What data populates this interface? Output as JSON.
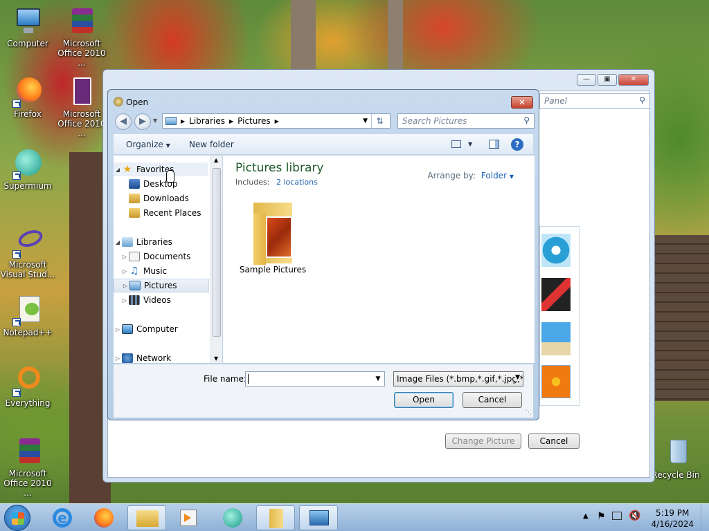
{
  "desktop": {
    "icons": [
      {
        "label": "Computer"
      },
      {
        "label": "Microsoft Office 2010 ..."
      },
      {
        "label": "Firefox"
      },
      {
        "label": "Microsoft Office 2010 ..."
      },
      {
        "label": "Supermium"
      },
      {
        "label": "Microsoft Visual Stud..."
      },
      {
        "label": "Notepad++"
      },
      {
        "label": "Everything"
      },
      {
        "label": "Microsoft Office 2010 ..."
      },
      {
        "label": "Recycle Bin"
      }
    ]
  },
  "back_window": {
    "search_placeholder": "Panel",
    "change_picture": "Change Picture",
    "cancel": "Cancel"
  },
  "dialog": {
    "title": "Open",
    "breadcrumb": [
      "Libraries",
      "Pictures"
    ],
    "search_placeholder": "Search Pictures",
    "toolbar": {
      "organize": "Organize",
      "new_folder": "New folder"
    },
    "tree": {
      "favorites": "Favorites",
      "desktop": "Desktop",
      "downloads": "Downloads",
      "recent": "Recent Places",
      "libraries": "Libraries",
      "documents": "Documents",
      "music": "Music",
      "pictures": "Pictures",
      "videos": "Videos",
      "computer": "Computer",
      "network": "Network"
    },
    "library": {
      "title": "Pictures library",
      "includes_label": "Includes:",
      "includes_link": "2 locations",
      "arrange_label": "Arrange by:",
      "arrange_value": "Folder"
    },
    "items": [
      {
        "label": "Sample Pictures"
      }
    ],
    "file_name_label": "File name:",
    "file_name_value": "",
    "filter": "Image Files (*.bmp,*.gif,*.jpg,*.",
    "open": "Open",
    "cancel": "Cancel"
  },
  "taskbar": {
    "time": "5:19 PM",
    "date": "4/16/2024"
  }
}
